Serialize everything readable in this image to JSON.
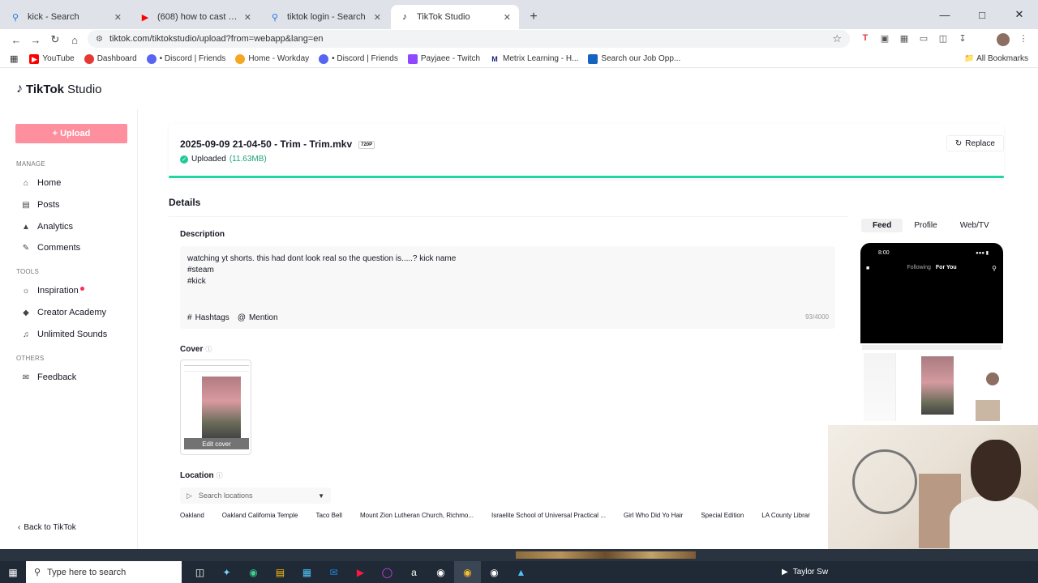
{
  "browser": {
    "tabs": [
      {
        "title": "kick - Search",
        "icon": "search-icon",
        "active": false
      },
      {
        "title": "(608) how to cast videos from",
        "icon": "youtube-icon",
        "active": false
      },
      {
        "title": "tiktok login - Search",
        "icon": "search-icon",
        "active": false
      },
      {
        "title": "TikTok Studio",
        "icon": "tiktok-icon",
        "active": true
      }
    ],
    "url": "tiktok.com/tiktokstudio/upload?from=webapp&lang=en",
    "bookmarks": [
      "YouTube",
      "Dashboard",
      "• Discord | Friends",
      "Home - Workday",
      "• Discord | Friends",
      "Payjaee - Twitch",
      "Metrix Learning - H...",
      "Search our Job Opp..."
    ],
    "all_bookmarks": "All Bookmarks",
    "colors": {
      "tab_strip": "#dfe3e9",
      "accent_pink": "#fe2c55"
    }
  },
  "app": {
    "brand": {
      "name": "TikTok",
      "suffix": "Studio"
    },
    "sidebar": {
      "upload_label": "+ Upload",
      "manage_heading": "MANAGE",
      "manage_items": [
        {
          "label": "Home",
          "icon": "home-icon"
        },
        {
          "label": "Posts",
          "icon": "posts-icon"
        },
        {
          "label": "Analytics",
          "icon": "analytics-icon"
        },
        {
          "label": "Comments",
          "icon": "comments-icon"
        }
      ],
      "tools_heading": "TOOLS",
      "tools_items": [
        {
          "label": "Inspiration",
          "icon": "lightbulb-icon"
        },
        {
          "label": "Creator Academy",
          "icon": "academy-icon"
        },
        {
          "label": "Unlimited Sounds",
          "icon": "music-icon"
        }
      ],
      "others_heading": "OTHERS",
      "others_items": [
        {
          "label": "Feedback",
          "icon": "feedback-icon"
        }
      ],
      "back_label": "Back to TikTok"
    },
    "file": {
      "name": "2025-09-09 21-04-50 - Trim - Trim.mkv",
      "resolution": "720P",
      "status": "Uploaded",
      "size": "(11.63MB)",
      "replace_label": "Replace",
      "progress": 1.0
    },
    "details": {
      "title": "Details",
      "description_label": "Description",
      "description_lines": [
        "watching yt shorts. this had dont look real so the question is.....? kick name",
        "#steam",
        "#kick"
      ],
      "hashtags_label": "Hashtags",
      "mention_label": "Mention",
      "char_count": "93/4000",
      "cover_label": "Cover",
      "edit_cover_label": "Edit cover",
      "location_label": "Location",
      "location_placeholder": "Search locations",
      "location_suggestions": [
        "Oakland",
        "Oakland California Temple",
        "Taco Bell",
        "Mount Zion Lutheran Church, Richmo...",
        "Israelite School of Universal Practical ...",
        "Girl Who Did Yo Hair",
        "Special Edition",
        "LA County Librar"
      ]
    },
    "preview": {
      "tabs": [
        "Feed",
        "Profile",
        "Web/TV"
      ],
      "active_tab": "Feed",
      "phone_time": "8:00",
      "phone_nav_following": "Following",
      "phone_nav_foryou": "For You"
    }
  },
  "taskbar": {
    "search_placeholder": "Type here to search",
    "right_text": "Taylor Sw"
  }
}
